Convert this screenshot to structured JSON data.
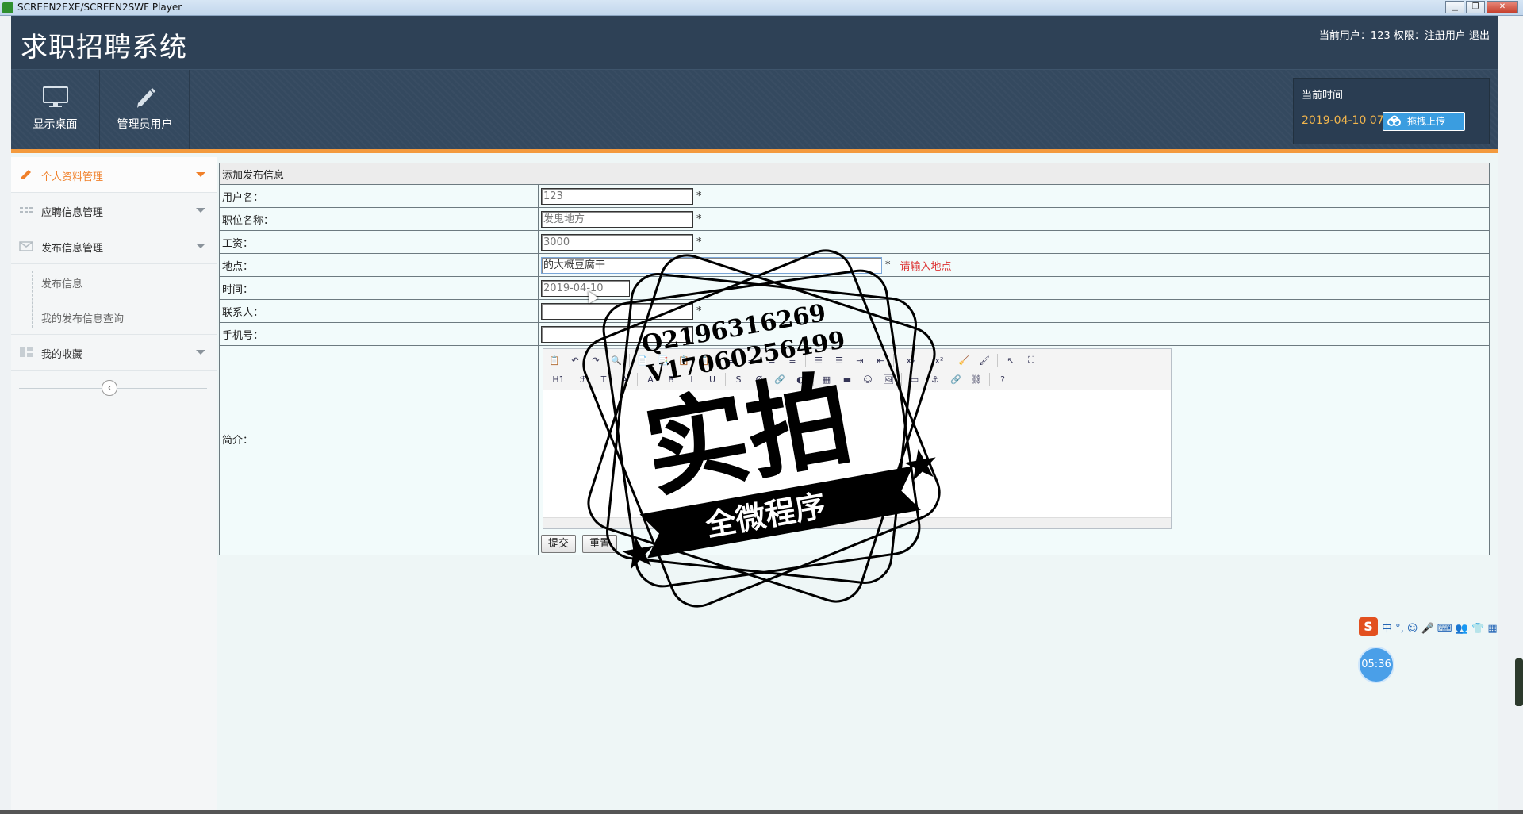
{
  "window": {
    "title": "SCREEN2EXE/SCREEN2SWF Player",
    "min": "▁",
    "max": "❐",
    "close": "✕"
  },
  "header": {
    "logo": "求职招聘系统",
    "user_info": "当前用户：123 权限：注册用户 退出"
  },
  "toolbar": {
    "items": [
      {
        "label": "显示桌面",
        "icon": "monitor-icon"
      },
      {
        "label": "管理员用户",
        "icon": "pencil-icon"
      }
    ],
    "time_panel": {
      "title": "当前时间",
      "time": "2019-04-10 07:",
      "upload_label": "拖拽上传"
    }
  },
  "sidebar": {
    "menus": [
      {
        "label": "个人资料管理",
        "icon": "pencil-icon",
        "active": true
      },
      {
        "label": "应聘信息管理",
        "icon": "grid-icon"
      },
      {
        "label": "发布信息管理",
        "icon": "mail-icon"
      },
      {
        "label": "我的收藏",
        "icon": "table-icon"
      }
    ],
    "submenu": [
      "发布信息",
      "我的发布信息查询"
    ],
    "collapse_symbol": "‹"
  },
  "form": {
    "title": "添加发布信息",
    "fields": {
      "username": {
        "label": "用户名：",
        "value": "123",
        "required": "*"
      },
      "job_title": {
        "label": "职位名称：",
        "value": "发鬼地方",
        "required": "*"
      },
      "salary": {
        "label": "工资：",
        "value": "3000",
        "required": "*"
      },
      "location": {
        "label": "地点：",
        "value": "的大概豆腐干",
        "required": "*",
        "error": "请输入地点"
      },
      "time": {
        "label": "时间：",
        "value": "2019-04-10"
      },
      "contact": {
        "label": "联系人：",
        "value": "",
        "required": "*"
      },
      "phone": {
        "label": "手机号：",
        "value": ""
      },
      "intro": {
        "label": "简介："
      }
    },
    "editor": {
      "row1": [
        "📋",
        "↶",
        "↷",
        "🔍",
        "📄",
        "📑",
        "📋",
        "📋",
        "≡",
        "≡",
        "≡",
        "≡",
        "☰",
        "☰",
        "⇥",
        "⇤",
        "x₂",
        "x²",
        "🧹",
        "🖌",
        "↖",
        "⛶"
      ],
      "row2": [
        "H1",
        "ℱ",
        "T",
        "A",
        "A",
        "B",
        "I",
        "U",
        "S",
        "Ø",
        "🔗",
        "◐",
        "▦",
        "▬",
        "☺",
        "🖼",
        "▭",
        "⚓",
        "🔗",
        "⛓",
        "?"
      ]
    },
    "submit_label": "提交",
    "reset_label": "重置"
  },
  "watermark": {
    "line1": "Q2196316269",
    "line2": "V17060256499",
    "big": "实拍",
    "ribbon": "全微程序"
  },
  "widgets": {
    "ime_logo": "S",
    "ime_text": "中 °, ☺ 🎤 ⌨ 👥 👕 ▦",
    "timer": "05:36"
  }
}
